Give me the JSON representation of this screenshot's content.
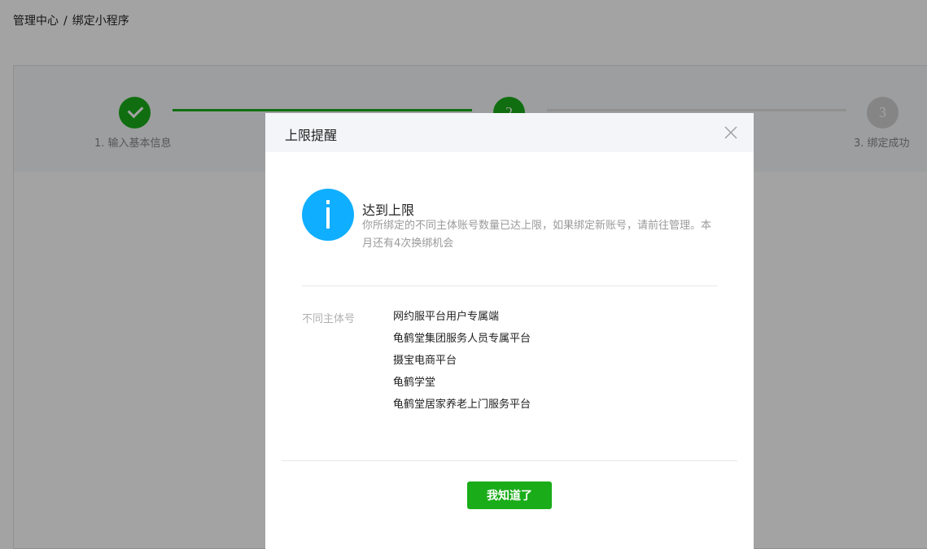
{
  "breadcrumb": {
    "root": "管理中心",
    "separator": "/",
    "current": "绑定小程序"
  },
  "steps": [
    {
      "number": "1",
      "label": "1. 输入基本信息",
      "state": "done"
    },
    {
      "number": "2",
      "label": "",
      "state": "active"
    },
    {
      "number": "3",
      "label": "3. 绑定成功",
      "state": "pending"
    }
  ],
  "dialog": {
    "title": "上限提醒",
    "close_icon": "close-icon",
    "status_icon": "info-icon",
    "message_title": "达到上限",
    "message_desc": "你所绑定的不同主体账号数量已达上限，如果绑定新账号，请前往管理。本月还有4次换绑机会",
    "entity_label": "不同主体号",
    "entities": [
      "网约服平台用户专属端",
      "龟鹤堂集团服务人员专属平台",
      "摄宝电商平台",
      "龟鹤学堂",
      "龟鹤堂居家养老上门服务平台"
    ],
    "confirm_label": "我知道了"
  },
  "colors": {
    "primary": "#1aad19",
    "info": "#10aeff",
    "pending": "#d0d0d0"
  }
}
